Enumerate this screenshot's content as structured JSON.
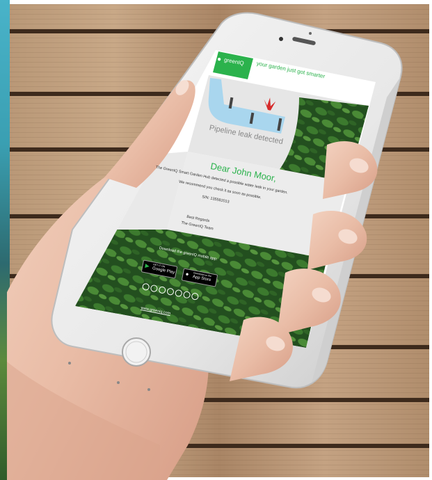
{
  "email": {
    "brand": "greenIQ",
    "tagline": "your garden just got smarter",
    "alert_caption": "Pipeline leak detected",
    "greeting": "Dear John Moor,",
    "body_line_1": "The GreenIQ Smart Garden Hub detected a possible water leak in your garden.",
    "body_line_2": "We recommend you check it as soon as possible.",
    "body_line_3": "S/N: 135582013",
    "signoff_1": "Best Regards",
    "signoff_2": "The GreenIQ Team",
    "download_text": "Download the greenIQ mobile app:",
    "google_play_small": "GET IT ON",
    "google_play_label": "Google Play",
    "app_store_small": "Download on the",
    "app_store_label": "App Store",
    "website": "www.greeniq.com"
  },
  "colors": {
    "brand_green": "#2bb24c",
    "pipe_blue": "#a9d6ee",
    "leaf_red": "#d62b2b",
    "leaf_dark": "#1f4a1c"
  },
  "icons": [
    "phone-speaker-icon",
    "camera-icon",
    "home-button-icon",
    "water-drop-logo-icon",
    "leak-splash-icon",
    "google-play-icon",
    "apple-icon",
    "social-icons"
  ]
}
